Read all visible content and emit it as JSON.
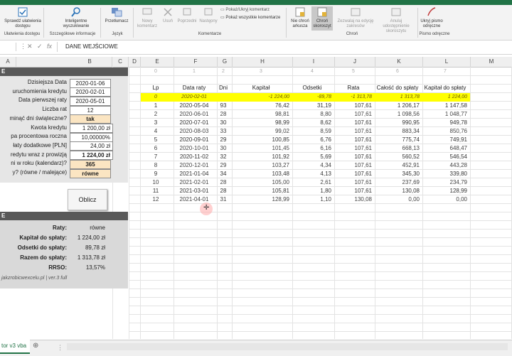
{
  "ribbon": {
    "items": [
      {
        "key": "spell",
        "label": "Sprawdź ułatwienia dostępu",
        "enabled": true
      },
      {
        "key": "smart",
        "label": "Inteligentne wyszukiwanie",
        "enabled": true
      },
      {
        "key": "translate",
        "label": "Przetłumacz",
        "enabled": true
      },
      {
        "key": "new_comment",
        "label": "Nowy komentarz",
        "enabled": false
      },
      {
        "key": "delete",
        "label": "Usuń",
        "enabled": false
      },
      {
        "key": "prev",
        "label": "Poprzedni",
        "enabled": false
      },
      {
        "key": "next",
        "label": "Następny",
        "enabled": false
      },
      {
        "key": "unprotect",
        "label": "Nie chroń arkusza",
        "enabled": true
      },
      {
        "key": "protect_wb",
        "label": "Chroń skoroszyt",
        "enabled": true
      },
      {
        "key": "allow_edit",
        "label": "Zezwalaj na edycję zakresów",
        "enabled": false
      },
      {
        "key": "unshare",
        "label": "Anuluj udostępnienie skoroszytu",
        "enabled": false
      },
      {
        "key": "hide_ink",
        "label": "Ukryj pismo odręczne",
        "enabled": true
      }
    ],
    "comment_options": [
      "Pokaż/Ukryj komentarz",
      "Pokaż wszystkie komentarze"
    ],
    "groups": [
      "Ułatwienia dostępu",
      "Szczegółowe informacje",
      "Język",
      "Komentarze",
      "Chroń",
      "Pismo odręczne"
    ]
  },
  "formula_bar": {
    "cell_ref": "",
    "content": "DANE WEJŚCIOWE"
  },
  "column_headers": [
    "A",
    "B",
    "C",
    "D",
    "E",
    "F",
    "G",
    "H",
    "I",
    "J",
    "K",
    "L",
    "M"
  ],
  "left_panel": {
    "header_row": "E",
    "inputs": [
      {
        "label": "Dzisiejsza Data",
        "value": "2020-01-06"
      },
      {
        "label": "uruchomienia kredytu",
        "value": "2020-02-01"
      },
      {
        "label": "Data pierwszej raty",
        "value": "2020-05-01"
      },
      {
        "label": "Liczba rat",
        "value": "12"
      },
      {
        "label": "minąć dni świąteczne?",
        "value": "tak"
      },
      {
        "label": "Kwota kredytu",
        "value": "1 200,00 zł"
      },
      {
        "label": "pa procentowa roczna",
        "value": "10,00000%"
      },
      {
        "label": "łaty dodatkowe [PLN]",
        "value": "24,00 zł"
      },
      {
        "label": "redytu wraz z prowizją",
        "value": "1 224,00 zł"
      },
      {
        "label": "ni w roku (kalendarz)?",
        "value": "365"
      },
      {
        "label": "y? (równe / malejące)",
        "value": "równe"
      }
    ],
    "button": "Oblicz",
    "results_header": "E",
    "results": [
      {
        "label": "Raty:",
        "value": "równe"
      },
      {
        "label": "Kapitał do spłaty:",
        "value": "1 224,00 zł"
      },
      {
        "label": "Odsetki do spłaty:",
        "value": "89,78 zł"
      },
      {
        "label": "Razem do spłaty:",
        "value": "1 313,78 zł"
      },
      {
        "label": "RRSO:",
        "value": "13,57%"
      }
    ],
    "footer": "jakzrobicwexcelu.pl | ver.3 full"
  },
  "table": {
    "index_row": [
      "0",
      "1",
      "2",
      "3",
      "4",
      "5",
      "6",
      "7"
    ],
    "headers": [
      "Lp",
      "Data raty",
      "Dni",
      "Kapitał",
      "Odsetki",
      "Rata",
      "Całość do spłaty",
      "Kapitał do spłaty"
    ],
    "highlight_row": [
      "0",
      "2020-02-01",
      "",
      "-1 224,00",
      "-89,78",
      "-1 313,78",
      "1 313,78",
      "1 224,00"
    ],
    "rows": [
      [
        "1",
        "2020-05-04",
        "93",
        "76,42",
        "31,19",
        "107,61",
        "1 206,17",
        "1 147,58"
      ],
      [
        "2",
        "2020-06-01",
        "28",
        "98,81",
        "8,80",
        "107,61",
        "1 098,56",
        "1 048,77"
      ],
      [
        "3",
        "2020-07-01",
        "30",
        "98,99",
        "8,62",
        "107,61",
        "990,95",
        "949,78"
      ],
      [
        "4",
        "2020-08-03",
        "33",
        "99,02",
        "8,59",
        "107,61",
        "883,34",
        "850,76"
      ],
      [
        "5",
        "2020-09-01",
        "29",
        "100,85",
        "6,76",
        "107,61",
        "775,74",
        "749,91"
      ],
      [
        "6",
        "2020-10-01",
        "30",
        "101,45",
        "6,16",
        "107,61",
        "668,13",
        "648,47"
      ],
      [
        "7",
        "2020-11-02",
        "32",
        "101,92",
        "5,69",
        "107,61",
        "560,52",
        "546,54"
      ],
      [
        "8",
        "2020-12-01",
        "29",
        "103,27",
        "4,34",
        "107,61",
        "452,91",
        "443,28"
      ],
      [
        "9",
        "2021-01-04",
        "34",
        "103,48",
        "4,13",
        "107,61",
        "345,30",
        "339,80"
      ],
      [
        "10",
        "2021-02-01",
        "28",
        "105,00",
        "2,61",
        "107,61",
        "237,69",
        "234,79"
      ],
      [
        "11",
        "2021-03-01",
        "28",
        "105,81",
        "1,80",
        "107,61",
        "130,08",
        "128,99"
      ],
      [
        "12",
        "2021-04-01",
        "31",
        "128,99",
        "1,10",
        "130,08",
        "0,00",
        "0,00"
      ]
    ]
  },
  "sheet_tab": "tor v3 vba",
  "colors": {
    "excel_green": "#217346",
    "highlight": "#ffff00",
    "input_fill": "#fbe5c2",
    "panel_gray": "#d9d9d9"
  }
}
